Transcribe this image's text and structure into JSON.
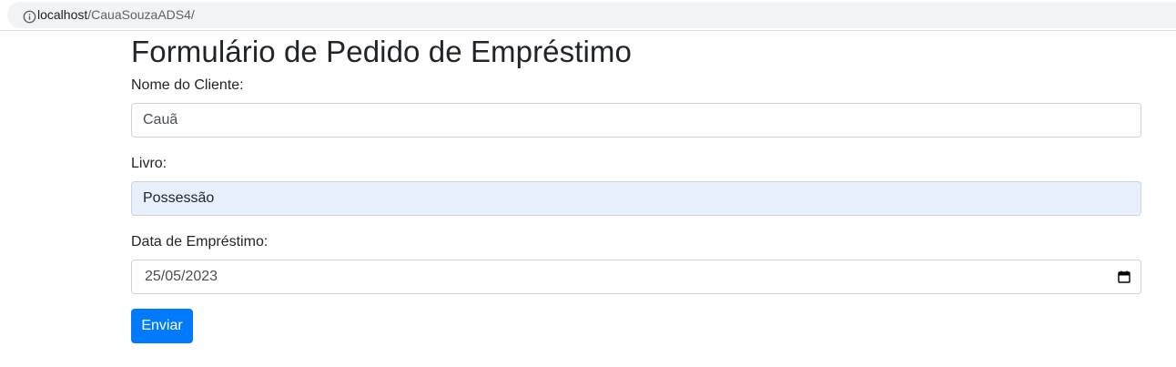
{
  "browser": {
    "url_host": "localhost",
    "url_path": "/CauaSouzaADS4/",
    "info_icon": "info-icon"
  },
  "form": {
    "title": "Formulário de Pedido de Empréstimo",
    "cliente": {
      "label": "Nome do Cliente:",
      "value": "Cauã"
    },
    "livro": {
      "label": "Livro:",
      "value": "Possessão"
    },
    "data": {
      "label": "Data de Empréstimo:",
      "value": "25/05/2023",
      "icon": "calendar-icon"
    },
    "submit_label": "Enviar"
  },
  "colors": {
    "primary": "#007bff",
    "autofill_bg": "#e8f0fe",
    "address_bar_bg": "#f1f3f4"
  }
}
